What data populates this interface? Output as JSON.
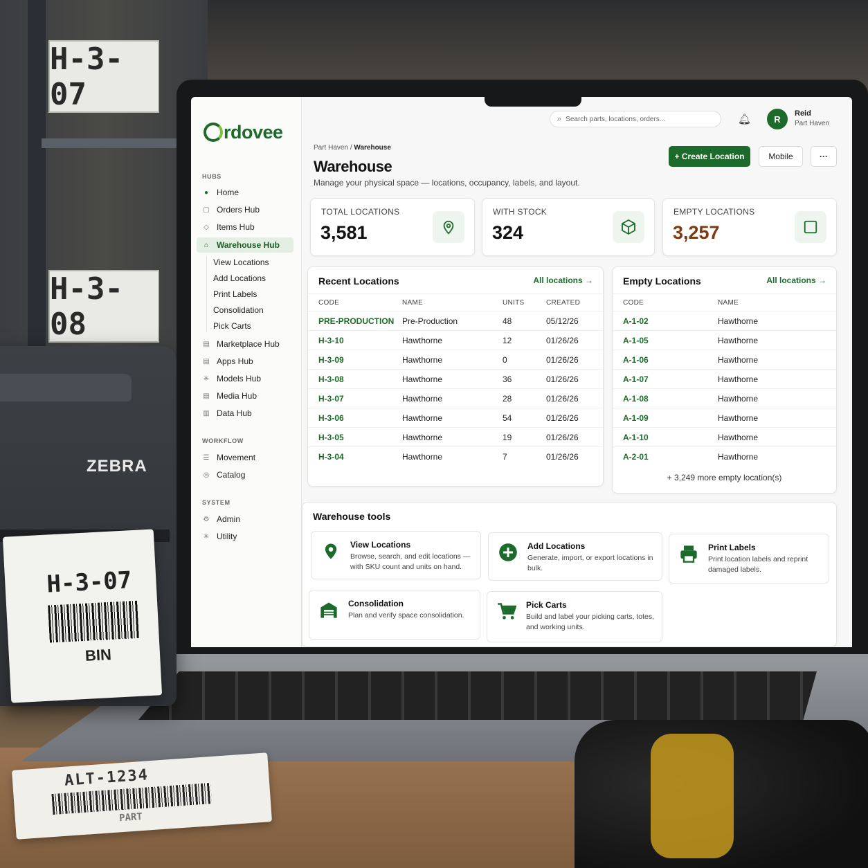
{
  "background": {
    "shelf_labels": [
      "H-3-07",
      "H-3-08"
    ],
    "printer_brand": "ZEBRA",
    "printer_label": {
      "code": "H-3-07",
      "kind": "BIN"
    },
    "desk_label": {
      "code": "ALT-1234",
      "kind": "PART"
    }
  },
  "app": {
    "brand": "rdovee",
    "accent": "#1d6b2a",
    "search_placeholder": "Search parts, locations, orders...",
    "user": {
      "initial": "R",
      "name": "Reid",
      "org": "Part Haven"
    }
  },
  "sidebar": {
    "sections": [
      {
        "title": "HUBS"
      },
      {
        "title": "WORKFLOW"
      },
      {
        "title": "SYSTEM"
      }
    ],
    "hubs": [
      {
        "label": "Home",
        "icon": "dot-icon"
      },
      {
        "label": "Orders Hub",
        "icon": "clipboard-icon"
      },
      {
        "label": "Items Hub",
        "icon": "tag-icon"
      },
      {
        "label": "Warehouse Hub",
        "icon": "warehouse-icon",
        "active": true
      }
    ],
    "warehouse_sub": [
      "View Locations",
      "Add Locations",
      "Print Labels",
      "Consolidation",
      "Pick Carts"
    ],
    "hubs_more": [
      {
        "label": "Marketplace Hub",
        "icon": "store-icon"
      },
      {
        "label": "Apps Hub",
        "icon": "apps-icon"
      },
      {
        "label": "Models Hub",
        "icon": "sparkle-icon"
      },
      {
        "label": "Media Hub",
        "icon": "media-icon"
      },
      {
        "label": "Data Hub",
        "icon": "database-icon"
      }
    ],
    "workflow": [
      {
        "label": "Movement",
        "icon": "list-icon"
      },
      {
        "label": "Catalog",
        "icon": "catalog-icon"
      }
    ],
    "system": [
      {
        "label": "Admin",
        "icon": "gear-icon"
      },
      {
        "label": "Utility",
        "icon": "sparkle-icon"
      }
    ]
  },
  "page": {
    "breadcrumb": [
      "Part Haven",
      "/",
      "Warehouse"
    ],
    "title": "Warehouse",
    "subtitle": "Manage your physical space — locations, occupancy, labels, and layout.",
    "actions": {
      "create": "+ Create Location",
      "mobile": "Mobile",
      "more": "···"
    }
  },
  "stats": [
    {
      "label": "TOTAL LOCATIONS",
      "value": "3,581",
      "icon": "map-pin-icon",
      "color": "#111111"
    },
    {
      "label": "WITH STOCK",
      "value": "324",
      "icon": "box-icon",
      "color": "#111111"
    },
    {
      "label": "EMPTY LOCATIONS",
      "value": "3,257",
      "icon": "empty-square-icon",
      "color": "#7a3b12"
    }
  ],
  "recent": {
    "title": "Recent Locations",
    "link": "All locations →",
    "columns": [
      "CODE",
      "NAME",
      "UNITS",
      "CREATED"
    ],
    "rows": [
      {
        "code": "PRE-PRODUCTION",
        "name": "Pre-Production",
        "units": "48",
        "created": "05/12/26"
      },
      {
        "code": "H-3-10",
        "name": "Hawthorne",
        "units": "12",
        "created": "01/26/26"
      },
      {
        "code": "H-3-09",
        "name": "Hawthorne",
        "units": "0",
        "created": "01/26/26"
      },
      {
        "code": "H-3-08",
        "name": "Hawthorne",
        "units": "36",
        "created": "01/26/26"
      },
      {
        "code": "H-3-07",
        "name": "Hawthorne",
        "units": "28",
        "created": "01/26/26"
      },
      {
        "code": "H-3-06",
        "name": "Hawthorne",
        "units": "54",
        "created": "01/26/26"
      },
      {
        "code": "H-3-05",
        "name": "Hawthorne",
        "units": "19",
        "created": "01/26/26"
      },
      {
        "code": "H-3-04",
        "name": "Hawthorne",
        "units": "7",
        "created": "01/26/26"
      }
    ]
  },
  "empty": {
    "title": "Empty Locations",
    "link": "All locations →",
    "columns": [
      "CODE",
      "NAME"
    ],
    "rows": [
      {
        "code": "A-1-02",
        "name": "Hawthorne"
      },
      {
        "code": "A-1-05",
        "name": "Hawthorne"
      },
      {
        "code": "A-1-06",
        "name": "Hawthorne"
      },
      {
        "code": "A-1-07",
        "name": "Hawthorne"
      },
      {
        "code": "A-1-08",
        "name": "Hawthorne"
      },
      {
        "code": "A-1-09",
        "name": "Hawthorne"
      },
      {
        "code": "A-1-10",
        "name": "Hawthorne"
      },
      {
        "code": "A-2-01",
        "name": "Hawthorne"
      }
    ],
    "more": "+ 3,249 more empty location(s)"
  },
  "tools": {
    "title": "Warehouse tools",
    "items": [
      {
        "title": "View Locations",
        "desc": "Browse, search, and edit locations — with SKU count and units on hand.",
        "icon": "map-pin-icon"
      },
      {
        "title": "Add Locations",
        "desc": "Generate, import, or export locations in bulk.",
        "icon": "plus-circle-icon"
      },
      {
        "title": "Print Labels",
        "desc": "Print location labels and reprint damaged labels.",
        "icon": "printer-icon"
      },
      {
        "title": "Consolidation",
        "desc": "Plan and verify space consolidation.",
        "icon": "warehouse-icon"
      },
      {
        "title": "Pick Carts",
        "desc": "Build and label your picking carts, totes, and working units.",
        "icon": "cart-icon"
      }
    ]
  }
}
